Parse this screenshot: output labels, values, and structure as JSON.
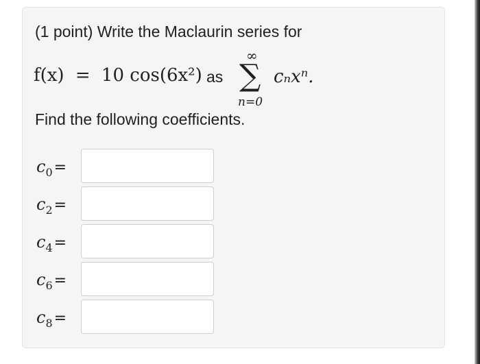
{
  "problem": {
    "intro": "(1 point) Write the Maclaurin series for",
    "function_lhs": "f(x)",
    "equals": "=",
    "function_rhs": "10 cos(6x²)",
    "as_word": "as",
    "sum_upper": "∞",
    "sum_symbol": "∑",
    "sum_lower": "n=0",
    "sum_term": "cₙxⁿ.",
    "instruction": "Find the following coefficients."
  },
  "coefficients": [
    {
      "symbol": "c",
      "index": "0",
      "equals": "=",
      "value": ""
    },
    {
      "symbol": "c",
      "index": "2",
      "equals": "=",
      "value": ""
    },
    {
      "symbol": "c",
      "index": "4",
      "equals": "=",
      "value": ""
    },
    {
      "symbol": "c",
      "index": "6",
      "equals": "=",
      "value": ""
    },
    {
      "symbol": "c",
      "index": "8",
      "equals": "=",
      "value": ""
    }
  ]
}
